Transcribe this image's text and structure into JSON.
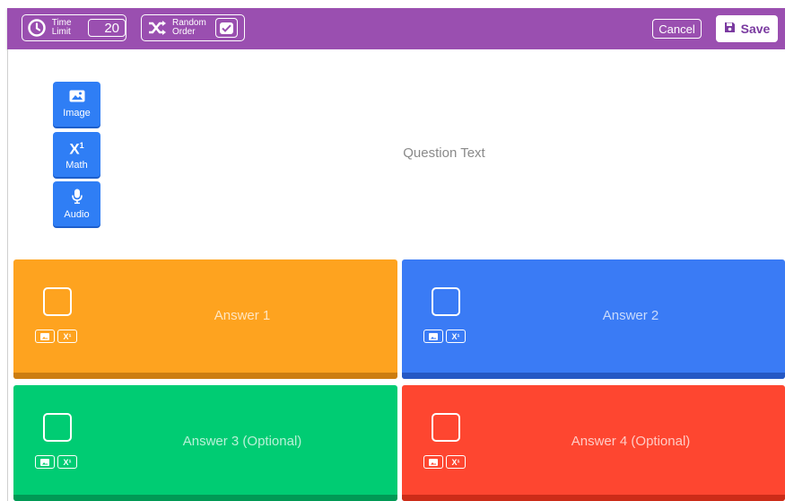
{
  "toolbar": {
    "time_limit": {
      "label_line1": "Time",
      "label_line2": "Limit",
      "value": "20",
      "icon": "clock-icon"
    },
    "random_order": {
      "label_line1": "Random",
      "label_line2": "Order",
      "checked": true,
      "icon": "shuffle-icon"
    },
    "cancel_label": "Cancel",
    "save_label": "Save",
    "save_icon": "floppy-disk-icon",
    "background_color": "#9a4fb0"
  },
  "question": {
    "placeholder": "Question Text",
    "media_buttons": [
      {
        "label": "Image",
        "icon": "image-icon"
      },
      {
        "label": "Math",
        "icon": "math-superscript-icon"
      },
      {
        "label": "Audio",
        "icon": "microphone-icon"
      }
    ]
  },
  "answers": [
    {
      "placeholder": "Answer 1",
      "color": "#fea31f",
      "correct": false
    },
    {
      "placeholder": "Answer 2",
      "color": "#3a7bf5",
      "correct": false
    },
    {
      "placeholder": "Answer 3 (Optional)",
      "color": "#00cc73",
      "correct": false
    },
    {
      "placeholder": "Answer 4 (Optional)",
      "color": "#fe4630",
      "correct": false
    }
  ],
  "answer_tools": {
    "math_glyph": "X¹"
  }
}
